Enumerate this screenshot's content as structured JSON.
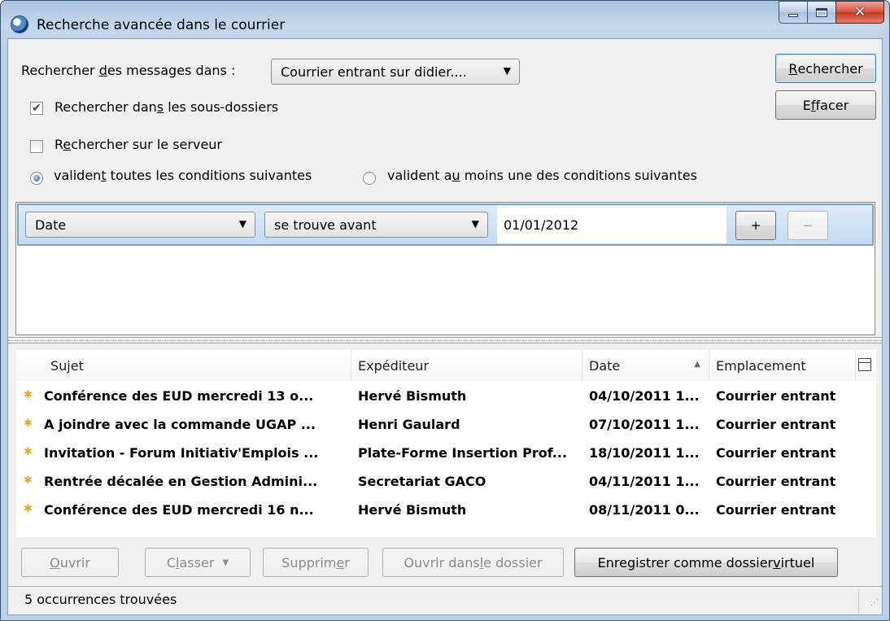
{
  "window": {
    "title": "Recherche avancée dans le courrier"
  },
  "search": {
    "folder_label_pre": "Rechercher ",
    "folder_label_key": "d",
    "folder_label_post": "es messages dans :",
    "folder_value": "Courrier entrant sur didier....",
    "search_button_key": "R",
    "search_button_post": "echercher",
    "clear_button_pre": "E",
    "clear_button_key": "f",
    "clear_button_post": "facer",
    "subfolders_pre": "Rechercher dan",
    "subfolders_key": "s",
    "subfolders_post": " les sous-dossiers",
    "subfolders_checked": true,
    "server_pre": "R",
    "server_key": "e",
    "server_post": "chercher sur le serveur",
    "server_checked": false,
    "match_all_pre": "validen",
    "match_all_key": "t",
    "match_all_post": " toutes les conditions suivantes",
    "match_any_pre": "valident a",
    "match_any_key": "u",
    "match_any_post": " moins une des conditions suivantes",
    "match_mode": "all"
  },
  "condition": {
    "field": "Date",
    "operator": "se trouve avant",
    "value": "01/01/2012",
    "add_label": "+",
    "remove_label": "−"
  },
  "results": {
    "columns": [
      "Sujet",
      "Expéditeur",
      "Date",
      "Emplacement"
    ],
    "sorted_column": "Date",
    "rows": [
      {
        "subject": "Conférence des EUD mercredi 13 o...",
        "sender": "Hervé Bismuth",
        "date": "04/10/2011 1...",
        "location": "Courrier entrant"
      },
      {
        "subject": "A joindre avec la commande UGAP ...",
        "sender": "Henri Gaulard",
        "date": "07/10/2011 1...",
        "location": "Courrier entrant"
      },
      {
        "subject": "Invitation - Forum Initiativ'Emplois ...",
        "sender": "Plate-Forme Insertion Prof...",
        "date": "18/10/2011 1...",
        "location": "Courrier entrant"
      },
      {
        "subject": "Rentrée décalée en Gestion Admini...",
        "sender": "Secretariat GACO",
        "date": "04/11/2011 1...",
        "location": "Courrier entrant"
      },
      {
        "subject": "Conférence des EUD mercredi 16 n...",
        "sender": "Hervé Bismuth",
        "date": "08/11/2011 0...",
        "location": "Courrier entrant"
      }
    ]
  },
  "actions": {
    "open_key": "O",
    "open_post": "uvrir",
    "classify_pre": "C",
    "classify_key": "l",
    "classify_post": "asser",
    "delete_pre": "Supprim",
    "delete_key": "e",
    "delete_post": "r",
    "open_folder_pre": "Ouvrir dans ",
    "open_folder_key": "l",
    "open_folder_post": "e dossier",
    "save_virtual_pre": "Enregistrer comme dossier ",
    "save_virtual_key": "v",
    "save_virtual_post": "irtuel"
  },
  "status": {
    "text": "5 occurrences trouvées"
  },
  "colors": {
    "star": "#e4a829",
    "selection_border": "#7da2ce"
  }
}
